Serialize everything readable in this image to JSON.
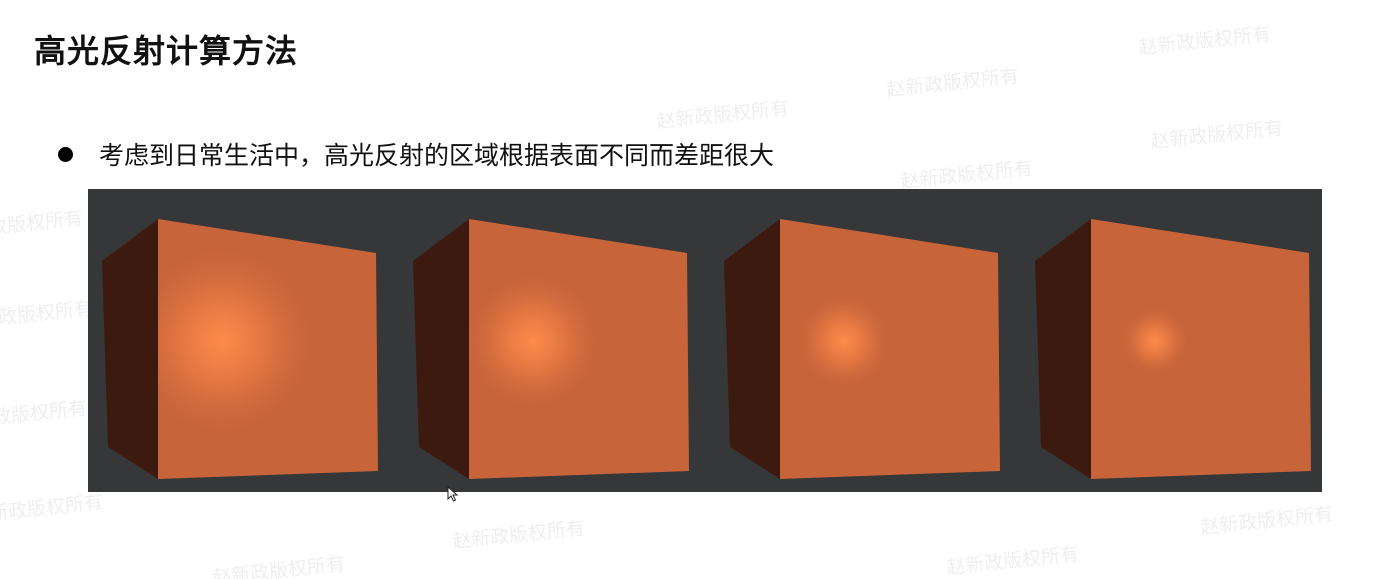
{
  "title": "高光反射计算方法",
  "bullet": "考虑到日常生活中，高光反射的区域根据表面不同而差距很大",
  "figure": {
    "panel_count": 4,
    "highlight_spread": [
      1.0,
      0.72,
      0.5,
      0.36
    ],
    "colors": {
      "background": "#363738",
      "front_face": "#c8643a",
      "side_face": "#3d1a0f",
      "highlight": "#ff8a4a"
    }
  },
  "watermark": "赵新政版权所有",
  "icons": [
    "cursor-icon"
  ]
}
